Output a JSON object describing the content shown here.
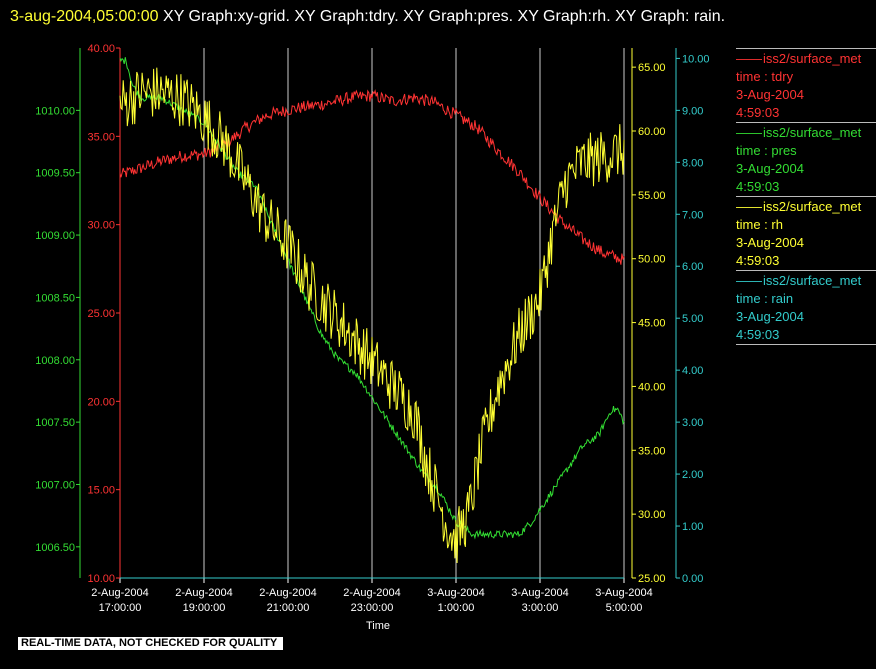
{
  "header": {
    "timestamp": "3-aug-2004,05:00:00",
    "graphs_text": "  XY Graph:xy-grid.  XY Graph:tdry.  XY Graph:pres.  XY Graph:rh.  XY Graph: rain."
  },
  "footer": {
    "quality_note": "REAL-TIME DATA, NOT CHECKED FOR QUALITY"
  },
  "chart_data": {
    "type": "line",
    "xlabel": "Time",
    "x_ticks": [
      [
        "2-Aug-2004",
        "17:00:00"
      ],
      [
        "2-Aug-2004",
        "19:00:00"
      ],
      [
        "2-Aug-2004",
        "21:00:00"
      ],
      [
        "2-Aug-2004",
        "23:00:00"
      ],
      [
        "3-Aug-2004",
        "1:00:00"
      ],
      [
        "3-Aug-2004",
        "3:00:00"
      ],
      [
        "3-Aug-2004",
        "5:00:00"
      ]
    ],
    "x_tick_hours": [
      0,
      2,
      4,
      6,
      8,
      10,
      12
    ],
    "xlim_hours": [
      0,
      12
    ],
    "grid": "vertical",
    "axes": [
      {
        "id": "pres",
        "side": "left",
        "color": "#33dd33",
        "ylim": [
          1006.25,
          1010.5
        ],
        "ticks": [
          "1006.50",
          "1007.00",
          "1007.50",
          "1008.00",
          "1008.50",
          "1009.00",
          "1009.50",
          "1010.00"
        ],
        "tick_values": [
          1006.5,
          1007.0,
          1007.5,
          1008.0,
          1008.5,
          1009.0,
          1009.5,
          1010.0
        ]
      },
      {
        "id": "tdry",
        "side": "left",
        "color": "#ff3333",
        "ylim": [
          10,
          40
        ],
        "ticks": [
          "10.00",
          "15.00",
          "20.00",
          "25.00",
          "30.00",
          "35.00",
          "40.00"
        ],
        "tick_values": [
          10,
          15,
          20,
          25,
          30,
          35,
          40
        ]
      },
      {
        "id": "rh",
        "side": "right",
        "color": "#ffff33",
        "ylim": [
          25,
          66.5
        ],
        "ticks": [
          "25.00",
          "30.00",
          "35.00",
          "40.00",
          "45.00",
          "50.00",
          "55.00",
          "60.00",
          "65.00"
        ],
        "tick_values": [
          25,
          30,
          35,
          40,
          45,
          50,
          55,
          60,
          65
        ]
      },
      {
        "id": "rain",
        "side": "right",
        "color": "#33cccc",
        "ylim": [
          0,
          10.2
        ],
        "ticks": [
          "0.00",
          "1.00",
          "2.00",
          "3.00",
          "4.00",
          "5.00",
          "6.00",
          "7.00",
          "8.00",
          "9.00",
          "10.00"
        ],
        "tick_values": [
          0,
          1,
          2,
          3,
          4,
          5,
          6,
          7,
          8,
          9,
          10
        ]
      }
    ],
    "series": [
      {
        "name": "iss2/surface_met",
        "field": "time : tdry",
        "date": "3-Aug-2004",
        "time": "4:59:03",
        "axis": "tdry",
        "color": "#ff3333",
        "x": [
          0,
          0.5,
          1,
          1.5,
          2,
          2.5,
          3,
          3.5,
          4,
          4.5,
          5,
          5.5,
          6,
          6.5,
          7,
          7.5,
          8,
          8.5,
          9,
          9.5,
          10,
          10.5,
          11,
          11.5,
          12
        ],
        "y": [
          32.8,
          33.2,
          33.6,
          33.9,
          34.0,
          34.5,
          35.5,
          36.2,
          36.5,
          36.7,
          36.9,
          37.2,
          37.3,
          37.0,
          37.2,
          36.9,
          36.2,
          35.5,
          34.2,
          33.0,
          31.5,
          30.2,
          29.2,
          28.4,
          28.0
        ],
        "noise": 0.35
      },
      {
        "name": "iss2/surface_met",
        "field": "time : pres",
        "date": "3-Aug-2004",
        "time": "4:59:03",
        "axis": "pres",
        "color": "#33dd33",
        "x": [
          0,
          0.15,
          0.3,
          0.5,
          1,
          1.5,
          2,
          2.4,
          2.8,
          3.2,
          3.6,
          4.0,
          4.4,
          4.8,
          5.2,
          5.6,
          6.0,
          6.4,
          6.8,
          7.2,
          7.6,
          8.0,
          8.4,
          8.8,
          9.2,
          9.5,
          9.8,
          10.2,
          10.6,
          11.0,
          11.4,
          11.7,
          11.85,
          12
        ],
        "y": [
          1010.4,
          1010.4,
          1010.2,
          1010.1,
          1010.1,
          1010.0,
          1009.9,
          1009.7,
          1009.5,
          1009.4,
          1009.1,
          1008.8,
          1008.5,
          1008.2,
          1008.0,
          1007.9,
          1007.7,
          1007.5,
          1007.3,
          1007.1,
          1006.95,
          1006.7,
          1006.6,
          1006.6,
          1006.6,
          1006.6,
          1006.7,
          1006.9,
          1007.1,
          1007.3,
          1007.4,
          1007.6,
          1007.6,
          1007.5
        ],
        "noise": 0.03
      },
      {
        "name": "iss2/surface_met",
        "field": "time : rh",
        "date": "3-Aug-2004",
        "time": "4:59:03",
        "axis": "rh",
        "color": "#ffff33",
        "x": [
          0,
          0.5,
          1,
          1.5,
          2,
          2.5,
          3,
          3.5,
          4,
          4.5,
          5,
          5.5,
          6,
          6.5,
          7,
          7.3,
          7.6,
          7.8,
          8,
          8.3,
          8.6,
          9,
          9.5,
          10,
          10.3,
          10.6,
          11,
          11.5,
          12
        ],
        "y": [
          62,
          63,
          63,
          62.5,
          61,
          59,
          56,
          53,
          51,
          48,
          46,
          44,
          42,
          40,
          38,
          34,
          31,
          29,
          28,
          30,
          35,
          40,
          44,
          47,
          52,
          56,
          57.5,
          58,
          58.5
        ],
        "noise": 2.2
      },
      {
        "name": "iss2/surface_met",
        "field": "time : rain",
        "date": "3-Aug-2004",
        "time": "4:59:03",
        "axis": "rain",
        "color": "#33cccc",
        "x": [
          0,
          12
        ],
        "y": [
          0,
          0
        ],
        "noise": 0
      }
    ]
  }
}
